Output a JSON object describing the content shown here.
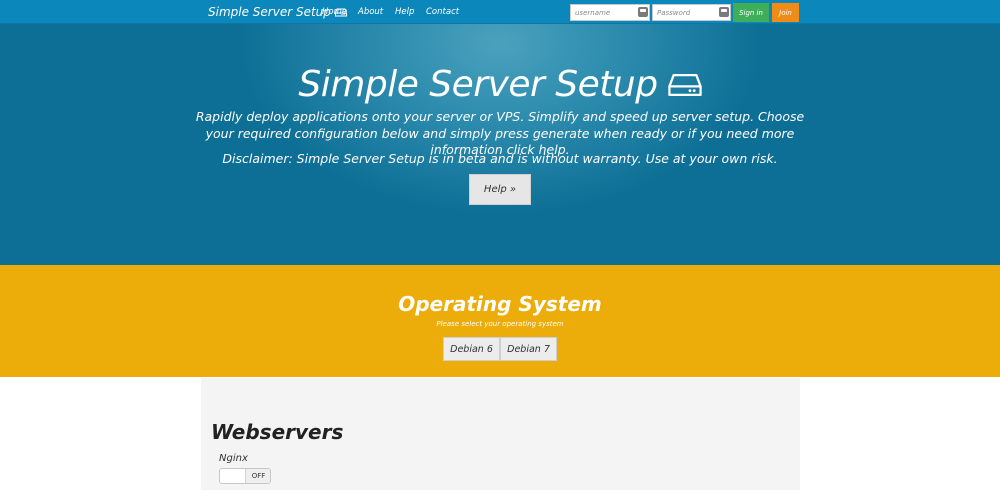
{
  "navbar": {
    "brand": "Simple Server Setup",
    "brand_icon": "hard-drive-icon",
    "links": [
      "Home",
      "About",
      "Help",
      "Contact"
    ],
    "username_placeholder": "username",
    "password_placeholder": "Password",
    "signin_label": "Sign in",
    "join_label": "Join",
    "colors": {
      "bar": "#0c87bc",
      "signin": "#3fae5a",
      "join": "#ee8c17"
    }
  },
  "hero": {
    "title": "Simple Server Setup",
    "subtitle": "Rapidly deploy applications onto your server or VPS. Simplify and speed up server setup. Choose your required configuration below and simply press generate when ready or if you need more information click help.",
    "disclaimer": "Disclaimer: Simple Server Setup is in beta and is without warranty. Use at your own risk.",
    "help_button": "Help »",
    "color": "#0e6f96"
  },
  "os": {
    "title": "Operating System",
    "subtitle": "Please select your operating system",
    "options": [
      "Debian 6",
      "Debian 7"
    ],
    "color": "#ecac0a"
  },
  "webservers": {
    "title": "Webservers",
    "items": [
      {
        "name": "Nginx",
        "state": "OFF"
      }
    ]
  }
}
